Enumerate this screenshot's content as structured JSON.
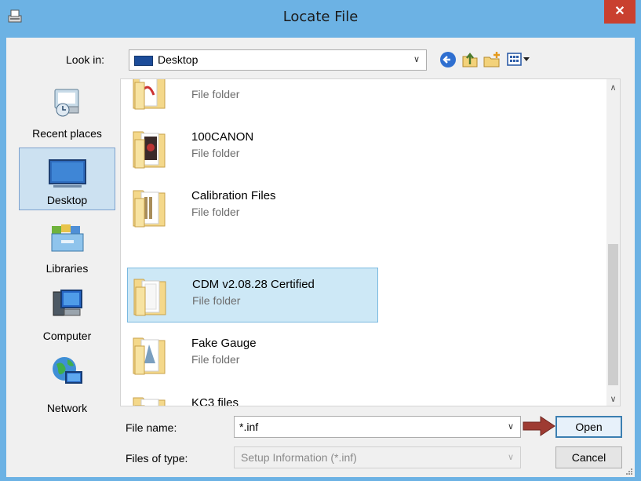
{
  "window": {
    "title": "Locate File",
    "close_glyph": "✕"
  },
  "lookin": {
    "label": "Look in:",
    "value": "Desktop"
  },
  "toolbar": {
    "icons": [
      "back-icon",
      "up-folder-icon",
      "new-folder-icon",
      "view-menu-icon"
    ]
  },
  "places": [
    {
      "label": "Recent places",
      "icon": "recent-places-icon"
    },
    {
      "label": "Desktop",
      "icon": "desktop-icon",
      "selected": true
    },
    {
      "label": "Libraries",
      "icon": "libraries-icon"
    },
    {
      "label": "Computer",
      "icon": "computer-icon"
    },
    {
      "label": "Network",
      "icon": "network-icon"
    }
  ],
  "files": [
    {
      "name": "",
      "type": "File folder"
    },
    {
      "name": "100CANON",
      "type": "File folder"
    },
    {
      "name": "Calibration Files",
      "type": "File folder"
    },
    {
      "name": "CDM v2.08.28 Certified",
      "type": "File folder",
      "selected": true
    },
    {
      "name": "Fake Gauge",
      "type": "File folder"
    },
    {
      "name": "KC3 files",
      "type": "File folder"
    }
  ],
  "filename": {
    "label": "File name:",
    "value": "*.inf"
  },
  "filetype": {
    "label": "Files of type:",
    "value": "Setup Information (*.inf)"
  },
  "buttons": {
    "open": "Open",
    "cancel": "Cancel"
  },
  "colors": {
    "titlebar": "#6cb2e4",
    "close": "#c9402f",
    "selection": "#cde8f6",
    "annotation_arrow": "#9e3b32"
  }
}
